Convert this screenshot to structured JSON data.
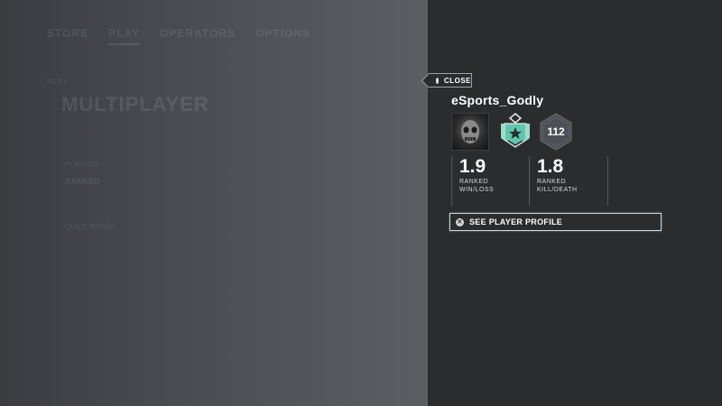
{
  "background_menu": {
    "nav": [
      "STORE",
      "PLAY",
      "OPERATORS",
      "OPTIONS"
    ],
    "breadcrumb": "PLAY",
    "title": "MULTIPLAYER",
    "sub_caption": "PLAYLIST",
    "sub_item": "RANKED",
    "footer": "QUICK MATCH"
  },
  "close": {
    "label": "CLOSE",
    "icon": "circle-button-icon"
  },
  "player": {
    "username": "eSports_Godly",
    "level": "112",
    "rank_icon": "diamond-rank-icon"
  },
  "stats": {
    "win_loss": {
      "value": "1.9",
      "label_line1": "RANKED",
      "label_line2": "WIN/LOSS"
    },
    "kill_death": {
      "value": "1.8",
      "label_line1": "RANKED",
      "label_line2": "KILL/DEATH"
    }
  },
  "profile_button": {
    "label": "SEE PLAYER PROFILE",
    "icon": "x-button-icon"
  },
  "colors": {
    "panel_bg": "#2b2c2e",
    "rank_teal": "#5fc7ae",
    "badge_gray": "#4d5055"
  }
}
